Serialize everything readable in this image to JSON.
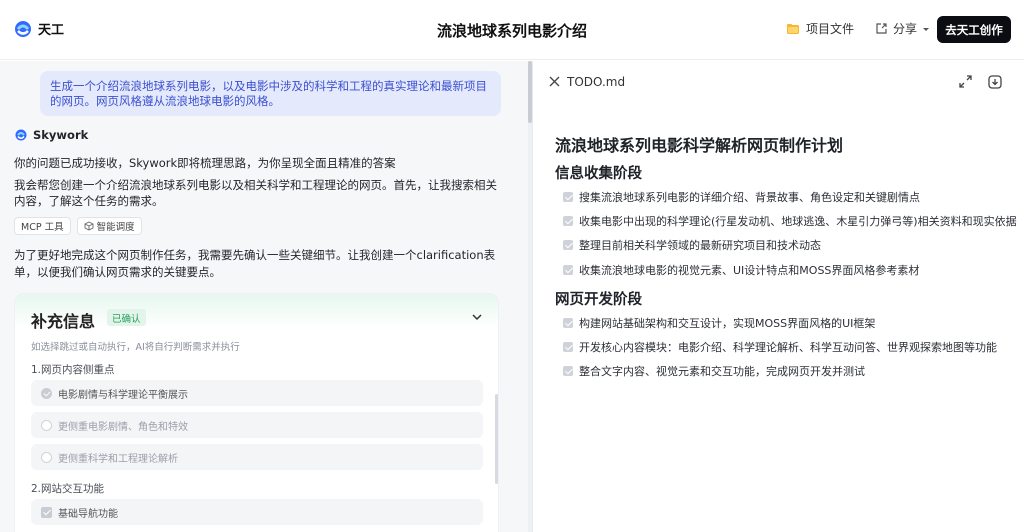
{
  "header": {
    "brand": "天工",
    "title": "流浪地球系列电影介绍",
    "project_files": "项目文件",
    "share": "分享",
    "create_button": "去天工创作"
  },
  "chat": {
    "user_message": "生成一个介绍流浪地球系列电影，以及电影中涉及的科学和工程的真实理论和最新项目的网页。网页风格遵从流浪地球电影的风格。",
    "assistant_name": "Skywork",
    "reply_1": "你的问题已成功接收，Skywork即将梳理思路，为你呈现全面且精准的答案",
    "reply_2": "我会帮您创建一个介绍流浪地球系列电影以及相关科学和工程理论的网页。首先，让我搜索相关内容，了解这个任务的需求。",
    "tools": [
      "MCP 工具",
      "智能调度"
    ],
    "reply_3": "为了更好地完成这个网页制作任务，我需要先确认一些关键细节。让我创建一个clarification表单，以便我们确认网页需求的关键要点。"
  },
  "form": {
    "title": "补充信息",
    "status": "已确认",
    "hint": "如选择跳过或自动执行，AI将自行判断需求并执行",
    "section_1": "1.网页内容侧重点",
    "section_1_options": [
      "电影剧情与科学理论平衡展示",
      "更侧重电影剧情、角色和特效",
      "更侧重科学和工程理论解析"
    ],
    "section_2": "2.网站交互功能",
    "section_2_options": [
      "基础导航功能"
    ]
  },
  "doc": {
    "filename": "TODO.md",
    "title": "流浪地球系列电影科学解析网页制作计划",
    "phase_1": "信息收集阶段",
    "phase_1_items": [
      "搜集流浪地球系列电影的详细介绍、背景故事、角色设定和关键剧情点",
      "收集电影中出现的科学理论(行星发动机、地球逃逸、木星引力弹弓等)相关资料和现实依据",
      "整理目前相关科学领域的最新研究项目和技术动态",
      "收集流浪地球电影的视觉元素、UI设计特点和MOSS界面风格参考素材"
    ],
    "phase_2": "网页开发阶段",
    "phase_2_items": [
      "构建网站基础架构和交互设计，实现MOSS界面风格的UI框架",
      "开发核心内容模块：电影介绍、科学理论解析、科学互动问答、世界观探索地图等功能",
      "整合文字内容、视觉元素和交互功能，完成网页开发并测试"
    ]
  },
  "colors": {
    "accent_blue": "#3b50d1",
    "user_bubble": "#e4e9fb",
    "confirmed_green": "#27a05a",
    "dark_button": "#0b0d12"
  }
}
